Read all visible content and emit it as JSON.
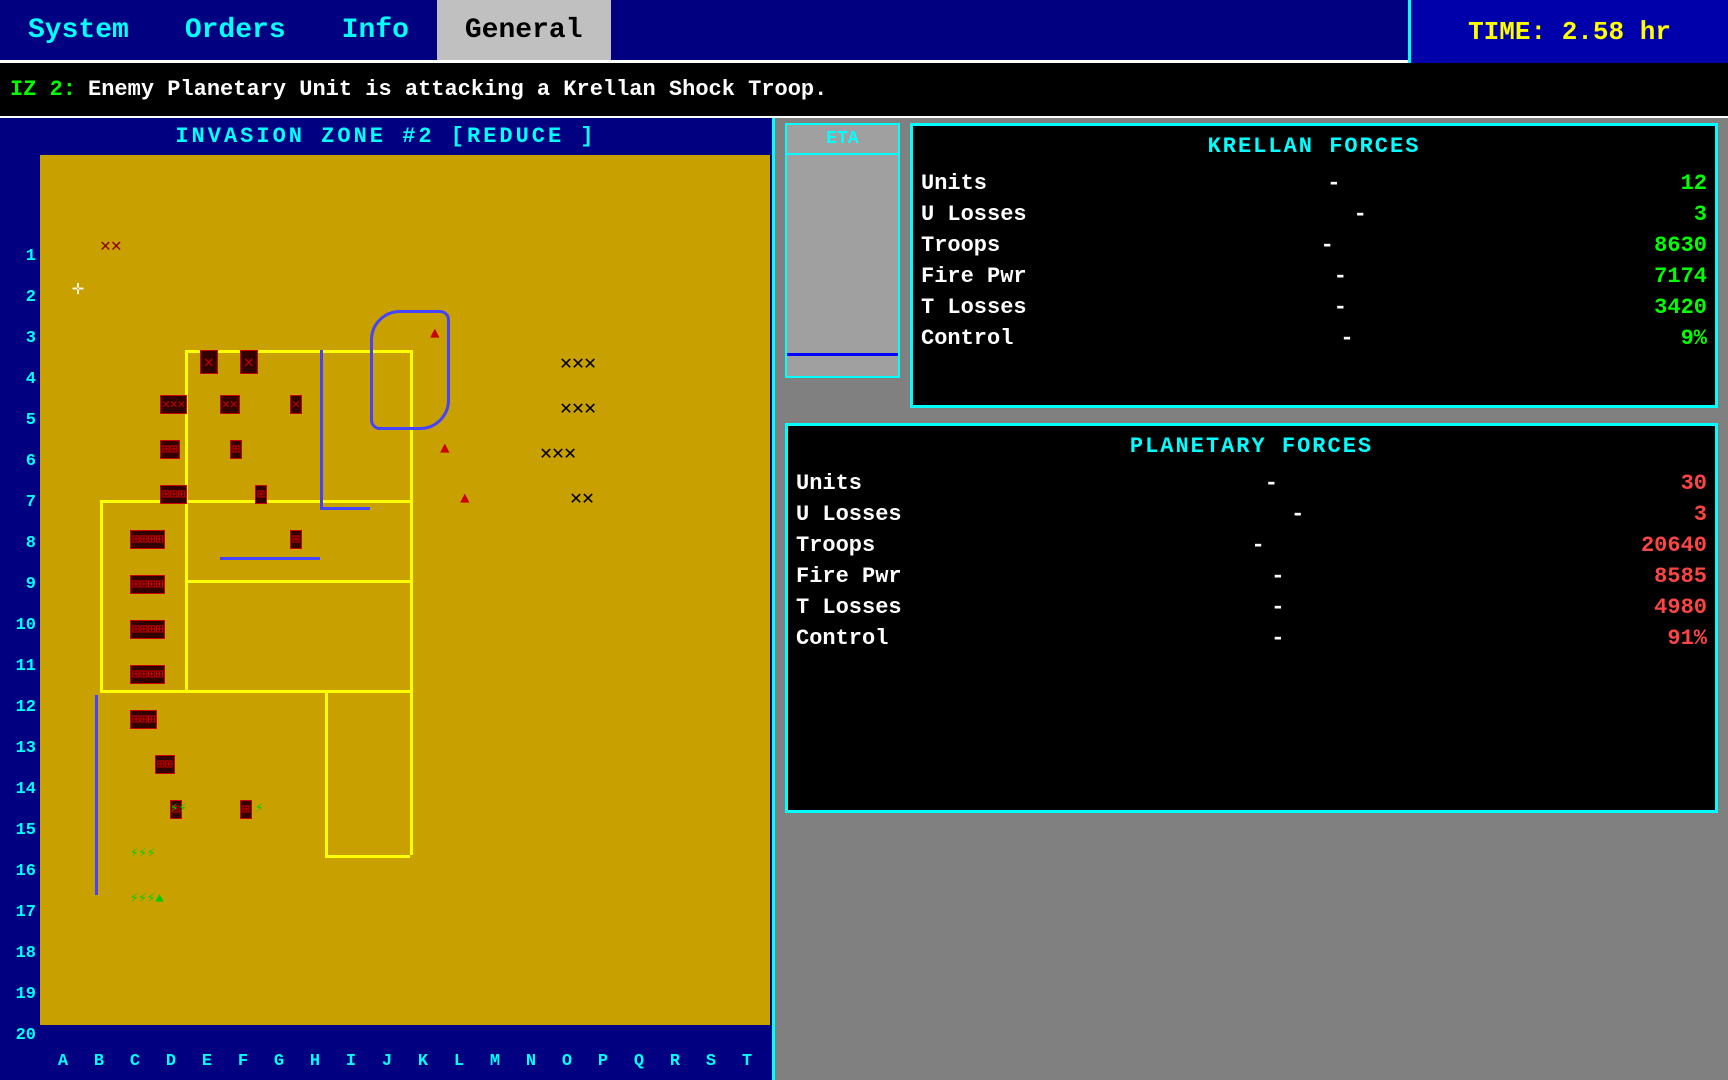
{
  "menu": {
    "items": [
      {
        "label": "System",
        "active": false
      },
      {
        "label": "Orders",
        "active": false
      },
      {
        "label": "Info",
        "active": false
      },
      {
        "label": "General",
        "active": true
      }
    ]
  },
  "time": {
    "label": "TIME:",
    "value": "2.58 hr"
  },
  "status": {
    "label": "IZ 2:",
    "text": "Enemy Planetary Unit is attacking a Krellan Shock Troop."
  },
  "map": {
    "title": "INVASION ZONE #2     [REDUCE ]",
    "rows": [
      "1",
      "2",
      "3",
      "4",
      "5",
      "6",
      "7",
      "8",
      "9",
      "10",
      "11",
      "12",
      "13",
      "14",
      "15",
      "16",
      "17",
      "18",
      "19",
      "20"
    ],
    "cols": [
      "A",
      "B",
      "C",
      "D",
      "E",
      "F",
      "G",
      "H",
      "I",
      "J",
      "K",
      "L",
      "M",
      "N",
      "O",
      "P",
      "Q",
      "R",
      "S",
      "T"
    ]
  },
  "eta": {
    "label": "ETA"
  },
  "krellan": {
    "title": "KRELLAN FORCES",
    "stats": [
      {
        "label": "Units",
        "value": "12"
      },
      {
        "label": "U Losses",
        "value": "3"
      },
      {
        "label": "Troops",
        "value": "8630"
      },
      {
        "label": "Fire Pwr",
        "value": "7174"
      },
      {
        "label": "T Losses",
        "value": "3420"
      },
      {
        "label": "Control",
        "value": "9%"
      }
    ]
  },
  "planetary": {
    "title": "PLANETARY FORCES",
    "stats": [
      {
        "label": "Units",
        "value": "30"
      },
      {
        "label": "U Losses",
        "value": "3"
      },
      {
        "label": "Troops",
        "value": "20640"
      },
      {
        "label": "Fire Pwr",
        "value": "8585"
      },
      {
        "label": "T Losses",
        "value": "4980"
      },
      {
        "label": "Control",
        "value": "91%"
      }
    ]
  }
}
